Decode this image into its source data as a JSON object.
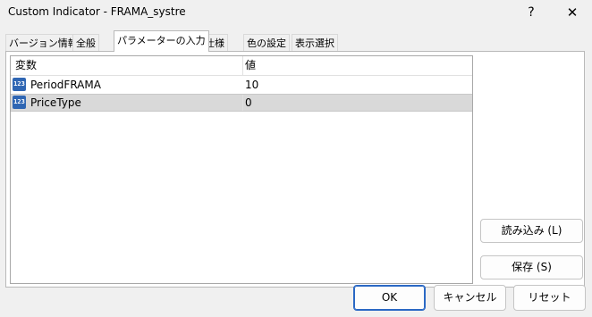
{
  "window": {
    "title": "Custom Indicator - FRAMA_systre",
    "help_glyph": "?",
    "close_glyph": "✕"
  },
  "tabs": [
    {
      "label": "バージョン情報",
      "active": false
    },
    {
      "label": "全般",
      "active": false
    },
    {
      "label": "パラメーターの入力",
      "active": true
    },
    {
      "label": "仕様",
      "active": false
    },
    {
      "label": "色の設定",
      "active": false
    },
    {
      "label": "表示選択",
      "active": false
    }
  ],
  "params": {
    "headers": {
      "variable": "変数",
      "value": "値"
    },
    "icon_text": "123",
    "rows": [
      {
        "name": "PeriodFRAMA",
        "value": "10"
      },
      {
        "name": "PriceType",
        "value": "0"
      }
    ]
  },
  "side_buttons": {
    "load": "読み込み (L)",
    "save": "保存 (S)"
  },
  "footer_buttons": {
    "ok": "OK",
    "cancel": "キャンセル",
    "reset": "リセット"
  },
  "colors": {
    "selected_row": "#d9d9d9",
    "param_icon": "#2f66b3",
    "primary_border": "#2a68c4"
  }
}
